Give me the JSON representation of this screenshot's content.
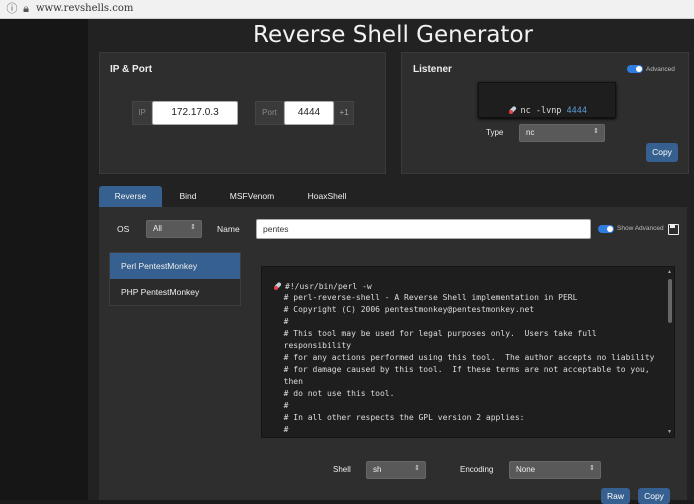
{
  "browser": {
    "url": "www.revshells.com"
  },
  "title": "Reverse Shell Generator",
  "ip_port": {
    "heading": "IP & Port",
    "ip_label": "IP",
    "ip_value": "172.17.0.3",
    "port_label": "Port",
    "port_value": "4444",
    "increment_label": "+1"
  },
  "listener": {
    "heading": "Listener",
    "advanced_label": "Advanced",
    "command_prefix": "nc -lvnp ",
    "command_port": "4444",
    "type_label": "Type",
    "type_value": "nc",
    "copy_label": "Copy"
  },
  "tabs": [
    {
      "label": "Reverse",
      "active": true
    },
    {
      "label": "Bind",
      "active": false
    },
    {
      "label": "MSFVenom",
      "active": false
    },
    {
      "label": "HoaxShell",
      "active": false
    }
  ],
  "filters": {
    "os_label": "OS",
    "os_value": "All",
    "name_label": "Name",
    "name_value": "pentes",
    "show_advanced_label": "Show Advanced"
  },
  "shell_list": [
    {
      "label": "Perl PentestMonkey",
      "active": true
    },
    {
      "label": "PHP PentestMonkey",
      "active": false
    }
  ],
  "code_lines": [
    "#!/usr/bin/perl -w",
    "  # perl-reverse-shell - A Reverse Shell implementation in PERL",
    "  # Copyright (C) 2006 pentestmonkey@pentestmonkey.net",
    "  #",
    "  # This tool may be used for legal purposes only.  Users take full",
    "  responsibility",
    "  # for any actions performed using this tool.  The author accepts no liability",
    "  # for damage caused by this tool.  If these terms are not acceptable to you,",
    "  then",
    "  # do not use this tool.",
    "  #",
    "  # In all other respects the GPL version 2 applies:",
    "  #"
  ],
  "bottom": {
    "shell_label": "Shell",
    "shell_value": "sh",
    "encoding_label": "Encoding",
    "encoding_value": "None",
    "raw_label": "Raw",
    "copy_label": "Copy"
  },
  "icons": {
    "info": "info-icon",
    "lock": "lock-icon",
    "rocket": "rocket-icon",
    "save": "save-icon"
  },
  "colors": {
    "accent": "#36608f",
    "toggle": "#2f7de1",
    "port_highlight": "#5b9bd5"
  }
}
